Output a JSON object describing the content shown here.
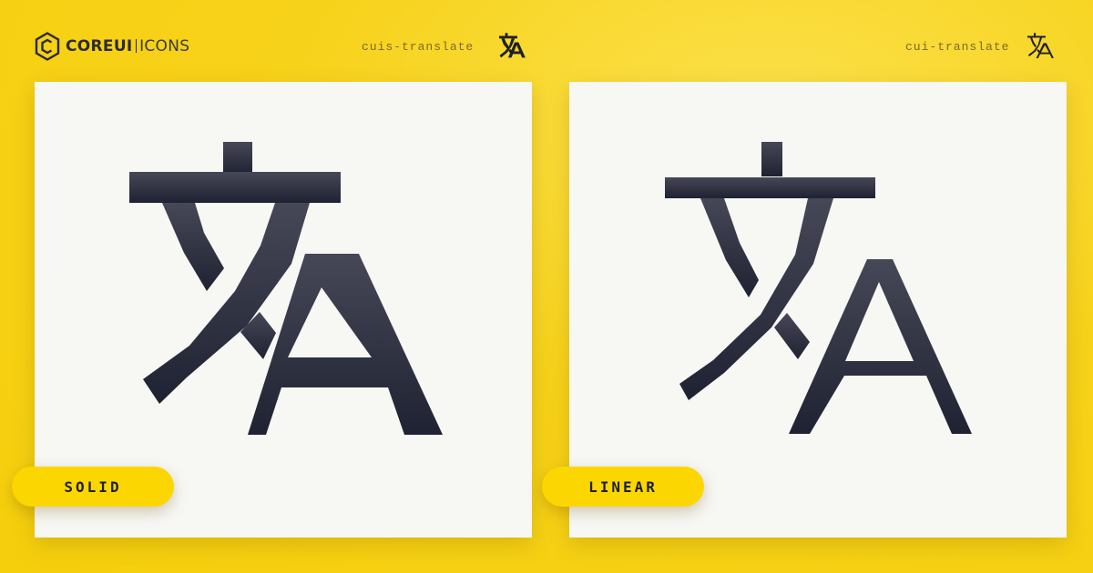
{
  "brand": {
    "logo_bold": "COREUI",
    "logo_light": "ICONS",
    "logo_icon": "hexagon-c-icon"
  },
  "panels": [
    {
      "icon_name": "cuis-translate",
      "variant_label": "SOLID",
      "icon": "translate-solid-icon"
    },
    {
      "icon_name": "cui-translate",
      "variant_label": "LINEAR",
      "icon": "translate-linear-icon"
    }
  ],
  "colors": {
    "background": "#f7d21a",
    "pill": "#fcd600",
    "glyph": "#2a2c38",
    "card": "#f7f7f4"
  }
}
